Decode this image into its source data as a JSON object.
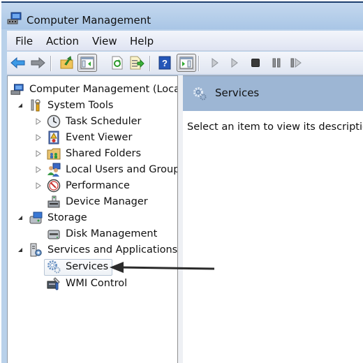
{
  "window": {
    "title": "Computer Management",
    "title_icon": "computer-management-icon"
  },
  "menubar": {
    "items": [
      "File",
      "Action",
      "View",
      "Help"
    ]
  },
  "toolbar": {
    "buttons": [
      {
        "name": "back",
        "icon": "back-arrow-icon",
        "enabled": true
      },
      {
        "name": "forward",
        "icon": "forward-arrow-icon",
        "enabled": false
      },
      {
        "name": "up-one-level",
        "icon": "folder-up-icon",
        "enabled": true
      },
      {
        "name": "show-hide-console-tree",
        "icon": "console-tree-icon",
        "pressed": true
      },
      {
        "name": "refresh",
        "icon": "refresh-icon",
        "enabled": true
      },
      {
        "name": "export-list",
        "icon": "export-list-icon",
        "enabled": true
      },
      {
        "name": "help",
        "icon": "help-icon",
        "enabled": true
      },
      {
        "name": "show-hide-action-pane",
        "icon": "action-pane-icon",
        "pressed": true
      },
      {
        "name": "start-service",
        "icon": "play-icon",
        "enabled": false
      },
      {
        "name": "start-service-alt",
        "icon": "play-icon",
        "enabled": false
      },
      {
        "name": "stop-service",
        "icon": "stop-icon",
        "enabled": false
      },
      {
        "name": "pause-service",
        "icon": "pause-icon",
        "enabled": false
      },
      {
        "name": "restart-service",
        "icon": "restart-icon",
        "enabled": false
      }
    ]
  },
  "tree": {
    "items": [
      {
        "label": "Computer Management (Local",
        "level": 0,
        "expander": "none",
        "icon": "computer-management-icon"
      },
      {
        "label": "System Tools",
        "level": 1,
        "expander": "expanded",
        "icon": "system-tools-icon"
      },
      {
        "label": "Task Scheduler",
        "level": 2,
        "expander": "collapsed",
        "icon": "clock-icon"
      },
      {
        "label": "Event Viewer",
        "level": 2,
        "expander": "collapsed",
        "icon": "event-viewer-icon"
      },
      {
        "label": "Shared Folders",
        "level": 2,
        "expander": "collapsed",
        "icon": "shared-folder-icon"
      },
      {
        "label": "Local Users and Groups",
        "level": 2,
        "expander": "collapsed",
        "icon": "users-icon"
      },
      {
        "label": "Performance",
        "level": 2,
        "expander": "collapsed",
        "icon": "performance-gauge-icon"
      },
      {
        "label": "Device Manager",
        "level": 2,
        "expander": "none",
        "icon": "device-manager-icon"
      },
      {
        "label": "Storage",
        "level": 1,
        "expander": "expanded",
        "icon": "storage-icon"
      },
      {
        "label": "Disk Management",
        "level": 2,
        "expander": "none",
        "icon": "disk-management-icon"
      },
      {
        "label": "Services and Applications",
        "level": 1,
        "expander": "expanded",
        "icon": "services-apps-icon"
      },
      {
        "label": "Services",
        "level": 2,
        "expander": "none",
        "icon": "gear-icon",
        "selected": true
      },
      {
        "label": "WMI Control",
        "level": 2,
        "expander": "none",
        "icon": "wmi-control-icon"
      }
    ]
  },
  "details": {
    "header_title": "Services",
    "header_icon": "gear-icon",
    "description_prompt": "Select an item to view its description"
  },
  "annotation": {
    "type": "arrow",
    "points_to": "Services"
  }
}
